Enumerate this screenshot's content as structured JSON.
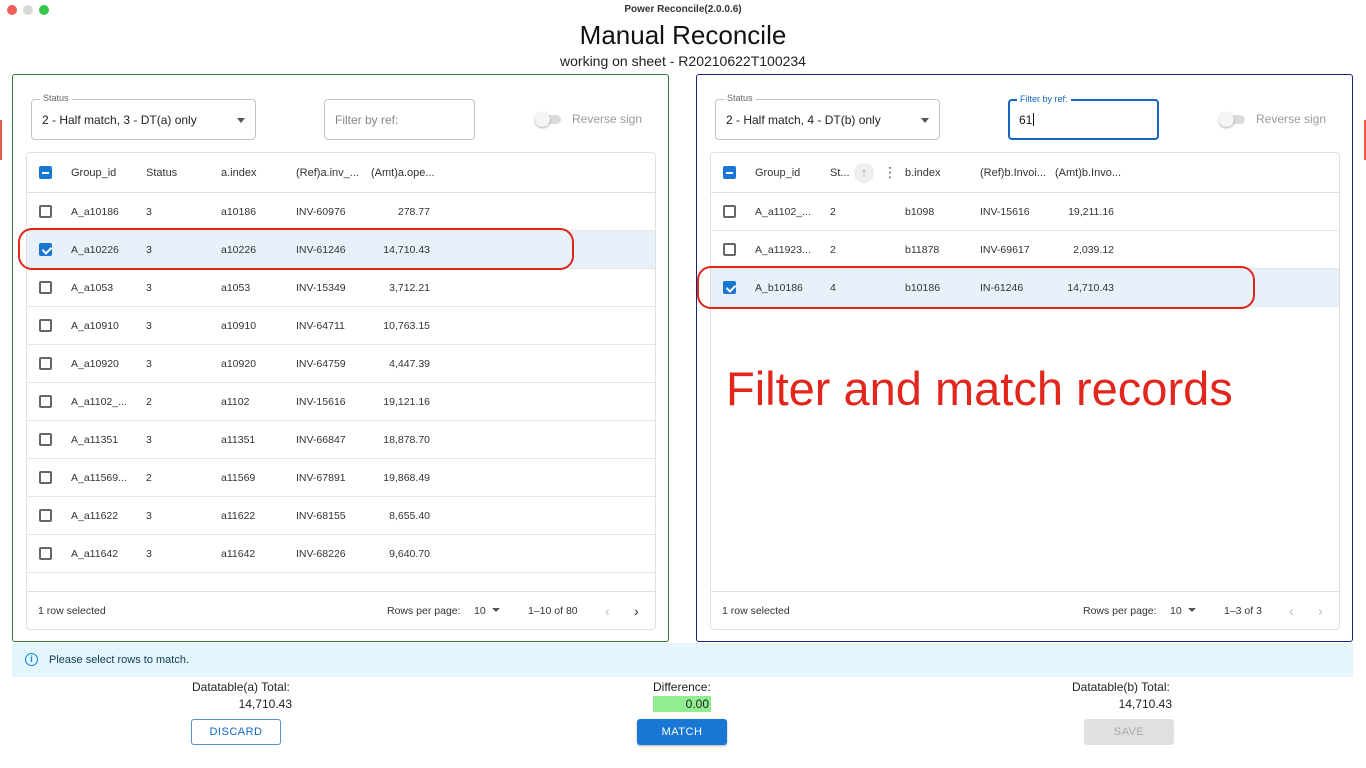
{
  "window": {
    "title": "Power Reconcile(2.0.0.6)"
  },
  "page": {
    "title": "Manual Reconcile",
    "subtitle": "working on sheet - R20210622T100234"
  },
  "colors": {
    "left_panel_border": "#2e7d32",
    "right_panel_border": "#1a237e",
    "accent": "#1976d2",
    "highlight": "#e0271a",
    "difference_bg": "#90ee90"
  },
  "left": {
    "status_label": "Status",
    "status_value": "2 - Half match, 3 - DT(a) only",
    "filter_placeholder": "Filter by ref:",
    "reverse_sign_label": "Reverse sign",
    "columns": [
      "Group_id",
      "Status",
      "a.index",
      "(Ref)a.inv_...",
      "(Amt)a.ope..."
    ],
    "rows": [
      {
        "group_id": "A_a10186",
        "status": "3",
        "index": "a10186",
        "ref": "INV-60976",
        "amt": "278.77"
      },
      {
        "group_id": "A_a10226",
        "status": "3",
        "index": "a10226",
        "ref": "INV-61246",
        "amt": "14,710.43"
      },
      {
        "group_id": "A_a1053",
        "status": "3",
        "index": "a1053",
        "ref": "INV-15349",
        "amt": "3,712.21"
      },
      {
        "group_id": "A_a10910",
        "status": "3",
        "index": "a10910",
        "ref": "INV-64711",
        "amt": "10,763.15"
      },
      {
        "group_id": "A_a10920",
        "status": "3",
        "index": "a10920",
        "ref": "INV-64759",
        "amt": "4,447.39"
      },
      {
        "group_id": "A_a1102_...",
        "status": "2",
        "index": "a1102",
        "ref": "INV-15616",
        "amt": "19,121.16"
      },
      {
        "group_id": "A_a11351",
        "status": "3",
        "index": "a11351",
        "ref": "INV-66847",
        "amt": "18,878.70"
      },
      {
        "group_id": "A_a11569...",
        "status": "2",
        "index": "a11569",
        "ref": "INV-67891",
        "amt": "19,868.49"
      },
      {
        "group_id": "A_a11622",
        "status": "3",
        "index": "a11622",
        "ref": "INV-68155",
        "amt": "8,655.40"
      },
      {
        "group_id": "A_a11642",
        "status": "3",
        "index": "a11642",
        "ref": "INV-68226",
        "amt": "9,640.70"
      }
    ],
    "selected_text": "1 row selected",
    "rows_per_page_label": "Rows per page:",
    "rows_per_page": "10",
    "page_range": "1–10 of 80",
    "prev_icon": "‹",
    "next_icon": "›"
  },
  "right": {
    "status_label": "Status",
    "status_value": "2 - Half match, 4 - DT(b) only",
    "filter_label": "Filter by ref:",
    "filter_value": "61",
    "reverse_sign_label": "Reverse sign",
    "columns": [
      "Group_id",
      "St...",
      "b.index",
      "(Ref)b.Invoi...",
      "(Amt)b.Invo..."
    ],
    "rows": [
      {
        "group_id": "A_a1102_...",
        "status": "2",
        "index": "b1098",
        "ref": "INV-15616",
        "amt": "19,211.16"
      },
      {
        "group_id": "A_a11923...",
        "status": "2",
        "index": "b11878",
        "ref": "INV-69617",
        "amt": "2,039.12"
      },
      {
        "group_id": "A_b10186",
        "status": "4",
        "index": "b10186",
        "ref": "IN-61246",
        "amt": "14,710.43"
      }
    ],
    "selected_text": "1 row selected",
    "rows_per_page_label": "Rows per page:",
    "rows_per_page": "10",
    "page_range": "1–3 of 3",
    "prev_icon": "‹",
    "next_icon": "›"
  },
  "annotation": "Filter and match records",
  "info": {
    "message": "Please select rows to match.",
    "icon": "i"
  },
  "totals": {
    "a_label": "Datatable(a) Total:",
    "a_value": "14,710.43",
    "diff_label": "Difference:",
    "diff_value": "0.00",
    "b_label": "Datatable(b) Total:",
    "b_value": "14,710.43"
  },
  "buttons": {
    "discard": "DISCARD",
    "match": "MATCH",
    "save": "SAVE"
  }
}
